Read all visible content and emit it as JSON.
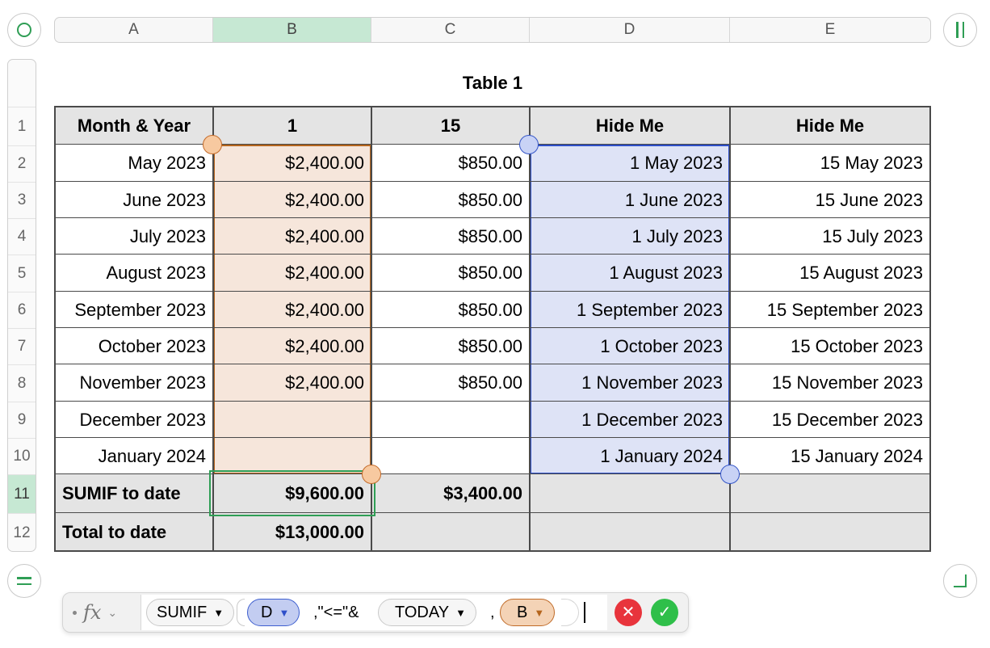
{
  "columns": [
    "A",
    "B",
    "C",
    "D",
    "E"
  ],
  "rows": [
    "1",
    "2",
    "3",
    "4",
    "5",
    "6",
    "7",
    "8",
    "9",
    "10",
    "11",
    "12"
  ],
  "table_title": "Table 1",
  "header": [
    "Month & Year",
    "1",
    "15",
    "Hide Me",
    "Hide Me"
  ],
  "body": [
    [
      "May 2023",
      "$2,400.00",
      "$850.00",
      "1 May 2023",
      "15 May 2023"
    ],
    [
      "June 2023",
      "$2,400.00",
      "$850.00",
      "1 June 2023",
      "15 June 2023"
    ],
    [
      "July 2023",
      "$2,400.00",
      "$850.00",
      "1 July 2023",
      "15 July 2023"
    ],
    [
      "August 2023",
      "$2,400.00",
      "$850.00",
      "1 August 2023",
      "15 August 2023"
    ],
    [
      "September 2023",
      "$2,400.00",
      "$850.00",
      "1 September 2023",
      "15 September 2023"
    ],
    [
      "October 2023",
      "$2,400.00",
      "$850.00",
      "1 October 2023",
      "15 October 2023"
    ],
    [
      "November 2023",
      "$2,400.00",
      "$850.00",
      "1 November 2023",
      "15 November 2023"
    ],
    [
      "December 2023",
      "",
      "",
      "1 December 2023",
      "15 December 2023"
    ],
    [
      "January 2024",
      "",
      "",
      "1 January 2024",
      "15 January 2024"
    ]
  ],
  "footer": [
    [
      "SUMIF to date",
      "$9,600.00",
      "$3,400.00",
      "",
      ""
    ],
    [
      "Total to date",
      "$13,000.00",
      "",
      "",
      ""
    ]
  ],
  "selected": {
    "column": "B",
    "row": "11"
  },
  "formula": {
    "fx_label": "fx",
    "tokens": [
      {
        "kind": "func",
        "text": "SUMIF"
      },
      {
        "kind": "ref-blue",
        "text": "D"
      },
      {
        "kind": "text",
        "text": ",\"<=\"&"
      },
      {
        "kind": "func",
        "text": "TODAY"
      },
      {
        "kind": "text",
        "text": ","
      },
      {
        "kind": "ref-orange",
        "text": "B"
      }
    ]
  },
  "colors": {
    "selection_green": "#2f9e55",
    "ref_orange": "#c06b28",
    "ref_blue": "#3e5fcf",
    "cancel_red": "#e8343c",
    "accept_green": "#2fbf4a"
  },
  "icons": [
    "add-table-icon",
    "freeze-columns-icon",
    "freeze-rows-icon",
    "resize-table-icon",
    "cancel-icon",
    "accept-icon",
    "chevron-down-icon"
  ]
}
